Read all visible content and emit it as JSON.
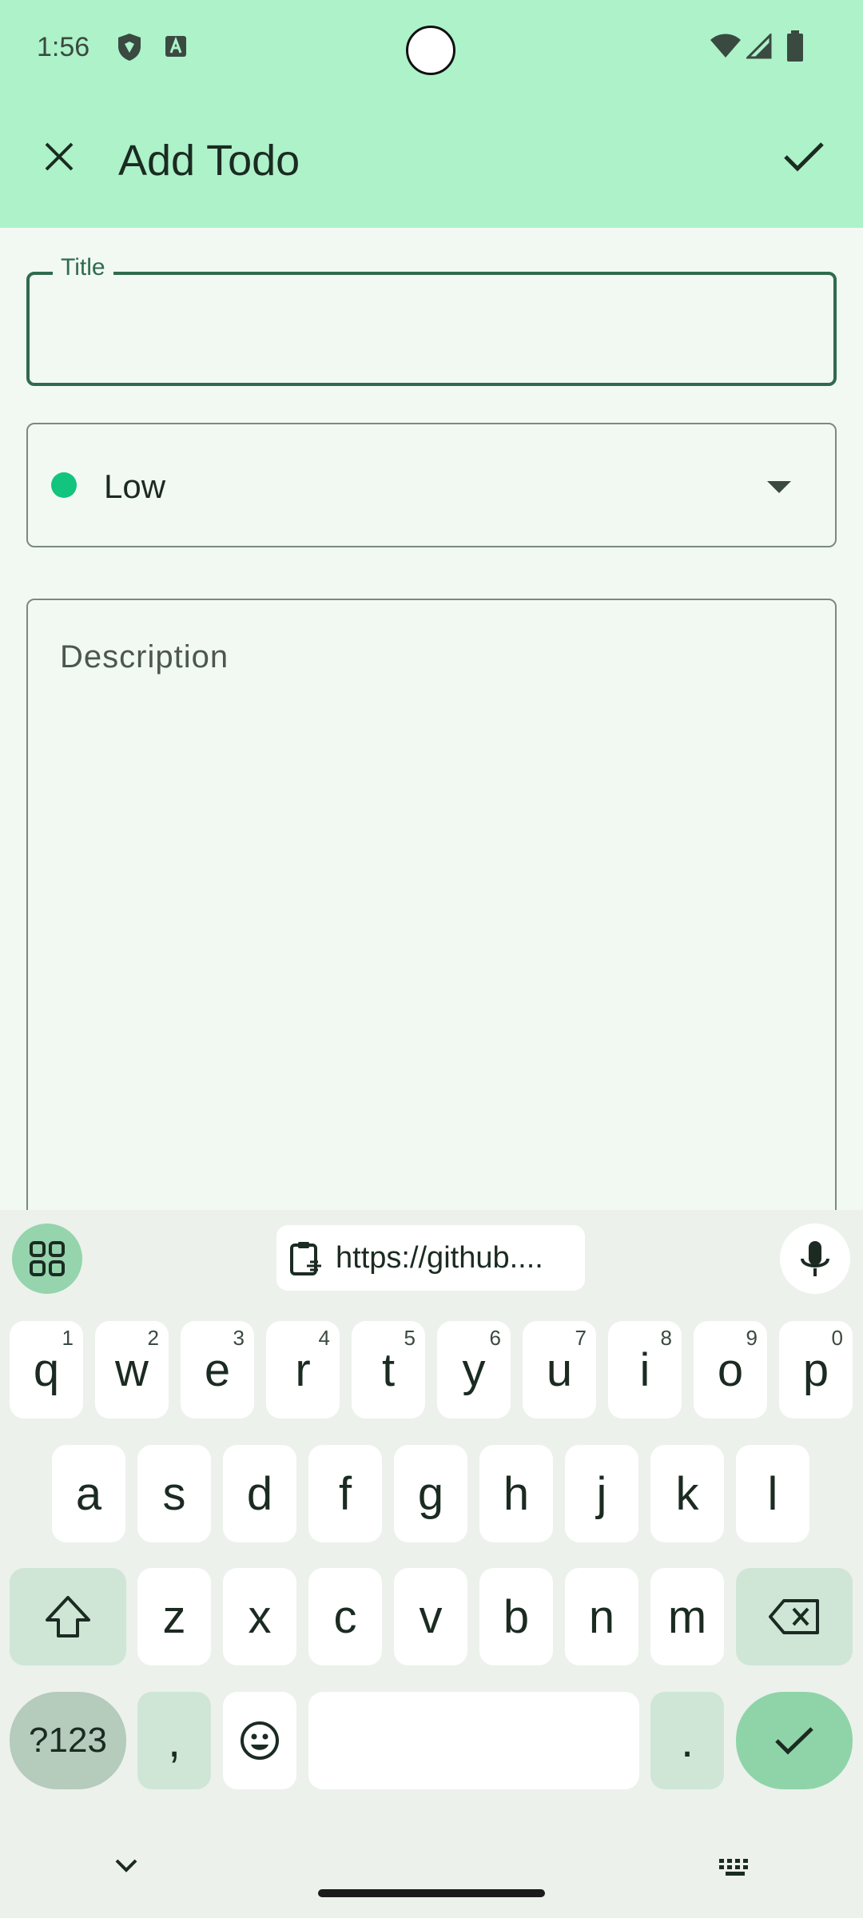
{
  "status": {
    "time": "1:56"
  },
  "appbar": {
    "title": "Add Todo"
  },
  "form": {
    "title_label": "Title",
    "title_value": "",
    "priority": {
      "label": "Low",
      "color": "#13c47e"
    },
    "description_placeholder": "Description"
  },
  "keyboard": {
    "clipboard_text": "https://github....",
    "row1": [
      {
        "k": "q",
        "n": "1"
      },
      {
        "k": "w",
        "n": "2"
      },
      {
        "k": "e",
        "n": "3"
      },
      {
        "k": "r",
        "n": "4"
      },
      {
        "k": "t",
        "n": "5"
      },
      {
        "k": "y",
        "n": "6"
      },
      {
        "k": "u",
        "n": "7"
      },
      {
        "k": "i",
        "n": "8"
      },
      {
        "k": "o",
        "n": "9"
      },
      {
        "k": "p",
        "n": "0"
      }
    ],
    "row2": [
      "a",
      "s",
      "d",
      "f",
      "g",
      "h",
      "j",
      "k",
      "l"
    ],
    "row3": [
      "z",
      "x",
      "c",
      "v",
      "b",
      "n",
      "m"
    ],
    "sym_label": "?123",
    "comma": ",",
    "period": "."
  },
  "colors": {
    "appbar": "#adf2c9",
    "accent": "#2f6b4e",
    "background": "#f2f9f2"
  }
}
